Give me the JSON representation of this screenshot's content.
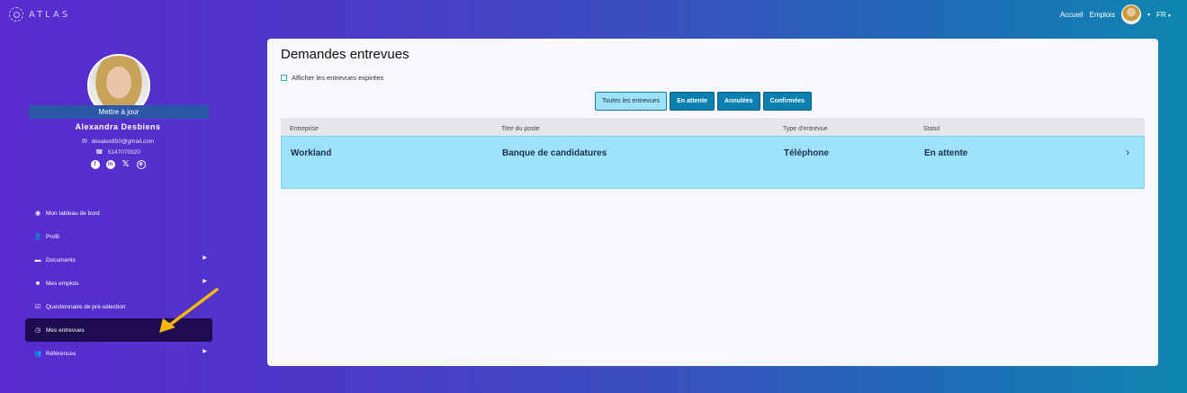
{
  "app": {
    "logo_text": "ATLAS"
  },
  "topnav": {
    "home": "Accueil",
    "jobs": "Emplois",
    "lang": "FR"
  },
  "profile": {
    "update_label": "Mettre à jour",
    "name": "Alexandra  Desbiens",
    "email": "desalex850@gmail.com",
    "phone": "5147070320",
    "socials": [
      "facebook-icon",
      "linkedin-icon",
      "x-icon",
      "globe-icon"
    ]
  },
  "sidebar": {
    "items": [
      {
        "label": "Mon tableau de bord",
        "icon": "dashboard-icon",
        "has_arrow": false
      },
      {
        "label": "Profil",
        "icon": "user-icon",
        "has_arrow": false
      },
      {
        "label": "Documents",
        "icon": "folder-icon",
        "has_arrow": true
      },
      {
        "label": "Mes emplois",
        "icon": "briefcase-icon",
        "has_arrow": true
      },
      {
        "label": "Questionnaire de pré-sélection",
        "icon": "checklist-icon",
        "has_arrow": false
      },
      {
        "label": "Mes entrevues",
        "icon": "clock-icon",
        "has_arrow": false,
        "active": true
      },
      {
        "label": "Références",
        "icon": "users-icon",
        "has_arrow": true
      }
    ]
  },
  "main": {
    "title": "Demandes entrevues",
    "show_expired_label": "Afficher les entrevues expirées",
    "filters": [
      "Toutes les entrevues",
      "En attente",
      "Annulées",
      "Confirmées"
    ],
    "active_filter": "Toutes les entrevues",
    "table": {
      "columns": [
        "Entreprise",
        "Titre du poste",
        "Type d'entrevue",
        "Statut"
      ],
      "rows": [
        {
          "company": "Workland",
          "position": "Banque de candidatures",
          "type": "Téléphone",
          "status": "En attente"
        }
      ]
    }
  },
  "colors": {
    "accent": "#0c7fb1",
    "row_highlight": "#9ee2f9",
    "sidebar_active": "#1f0b4f",
    "annotation_arrow": "#f5b70c"
  }
}
